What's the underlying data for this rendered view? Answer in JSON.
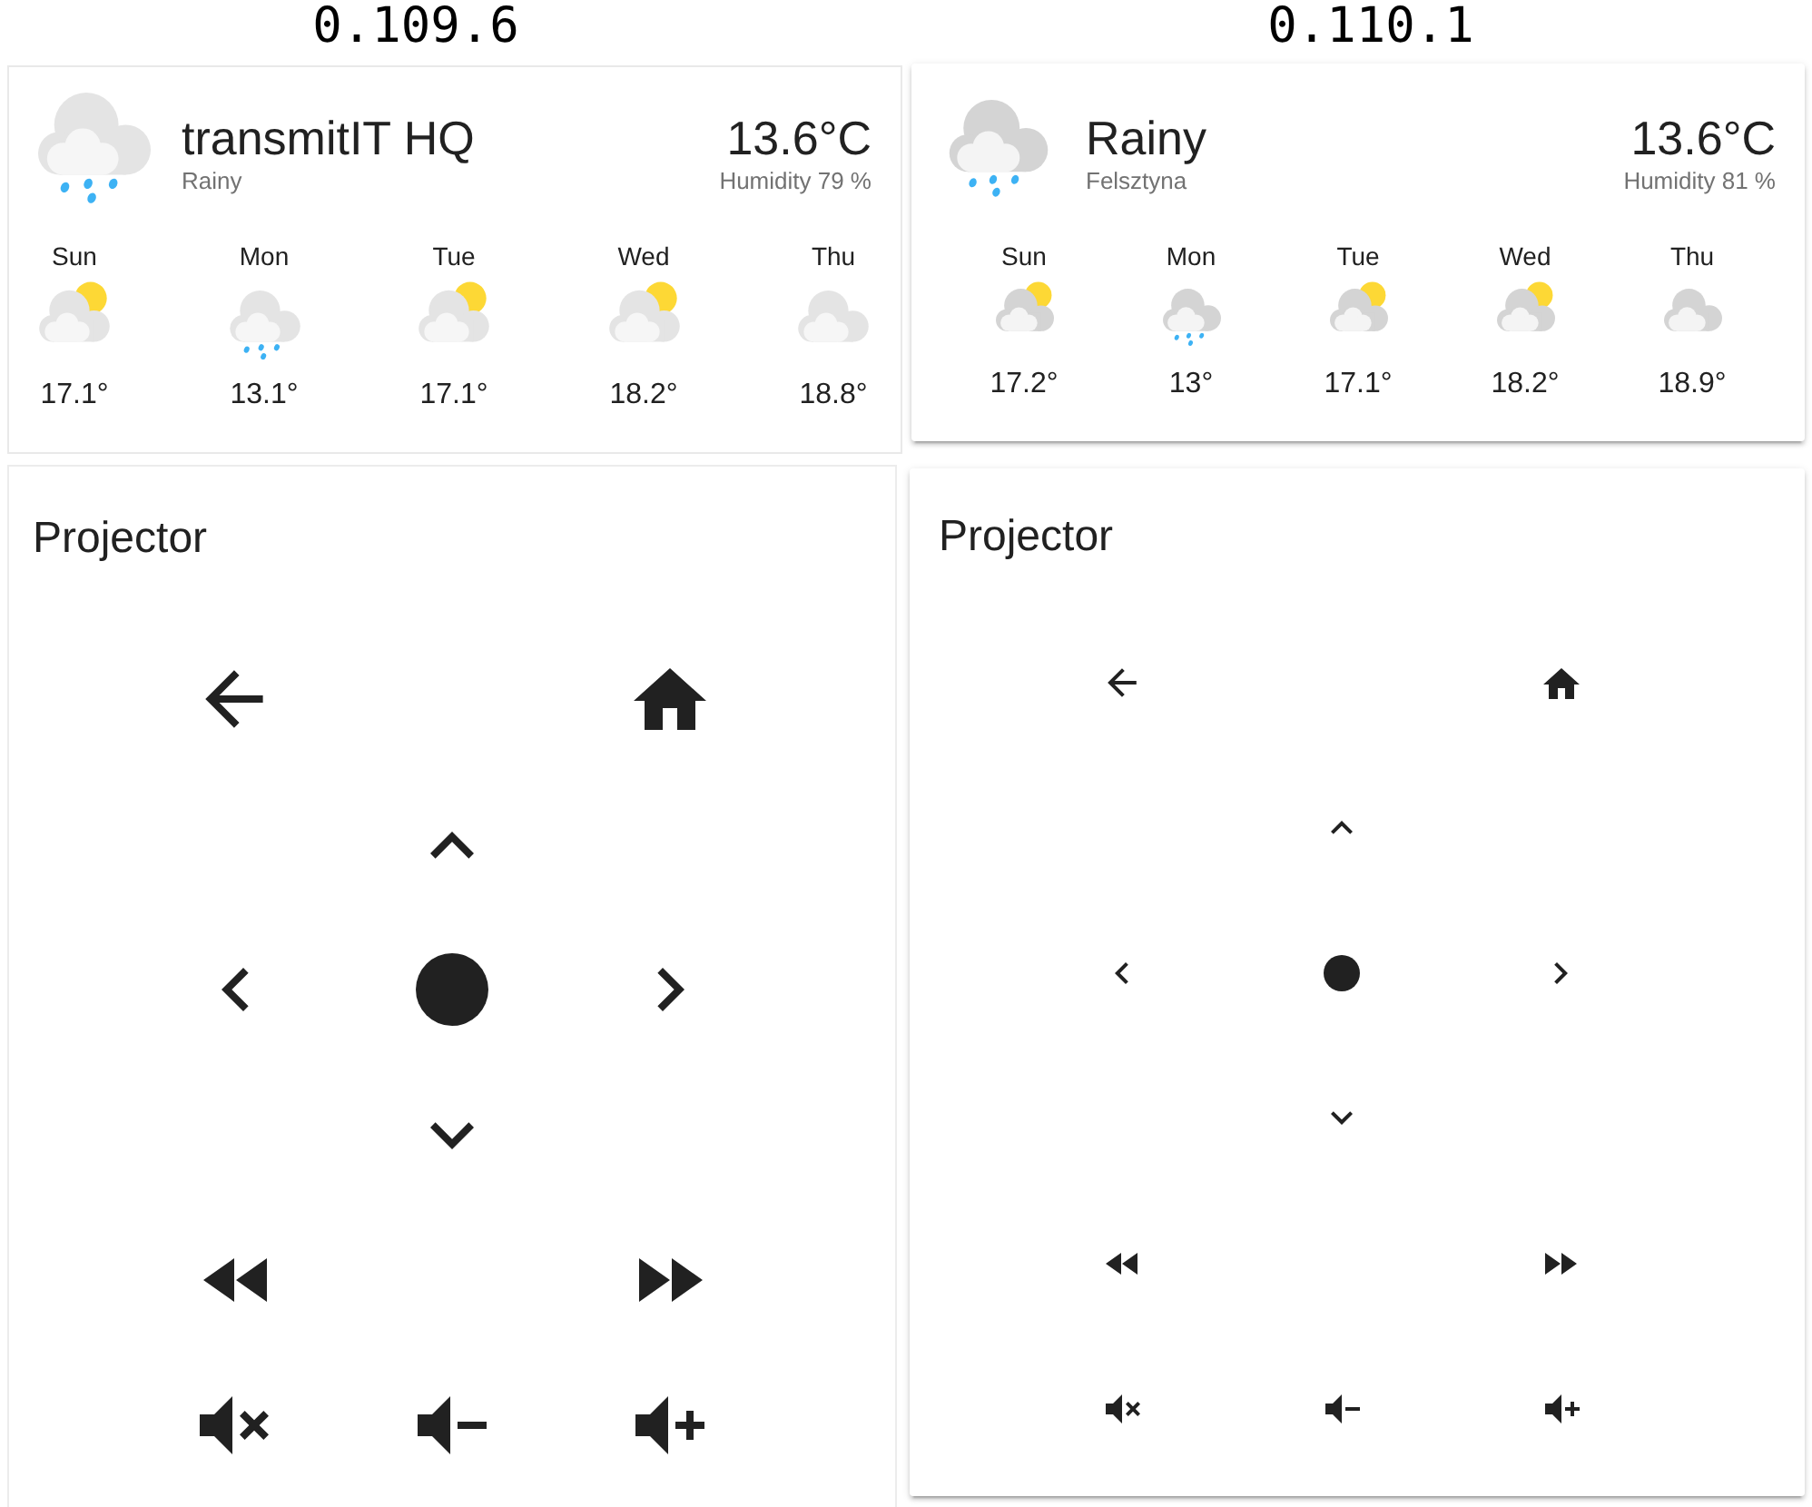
{
  "panels": [
    {
      "version": "0.109.6",
      "weather": {
        "kind": "rainy",
        "title": "transmitIT HQ",
        "subtitle": "Rainy",
        "temperature": "13.6°C",
        "humidity": "Humidity 79 %",
        "forecast": [
          {
            "day": "Sun",
            "kind": "partlycloudy",
            "temperature": "17.1°"
          },
          {
            "day": "Mon",
            "kind": "rainy",
            "temperature": "13.1°"
          },
          {
            "day": "Tue",
            "kind": "partlycloudy",
            "temperature": "17.1°"
          },
          {
            "day": "Wed",
            "kind": "partlycloudy",
            "temperature": "18.2°"
          },
          {
            "day": "Thu",
            "kind": "cloudy",
            "temperature": "18.8°"
          }
        ]
      },
      "remote": {
        "title": "Projector"
      }
    },
    {
      "version": "0.110.1",
      "weather": {
        "kind": "rainy",
        "title": "Rainy",
        "subtitle": "Felsztyna",
        "temperature": "13.6°C",
        "humidity": "Humidity 81 %",
        "forecast": [
          {
            "day": "Sun",
            "kind": "partlycloudy",
            "temperature": "17.2°"
          },
          {
            "day": "Mon",
            "kind": "rainy",
            "temperature": "13°"
          },
          {
            "day": "Tue",
            "kind": "partlycloudy",
            "temperature": "17.1°"
          },
          {
            "day": "Wed",
            "kind": "partlycloudy",
            "temperature": "18.2°"
          },
          {
            "day": "Thu",
            "kind": "cloudy",
            "temperature": "18.9°"
          }
        ]
      },
      "remote": {
        "title": "Projector"
      }
    }
  ]
}
